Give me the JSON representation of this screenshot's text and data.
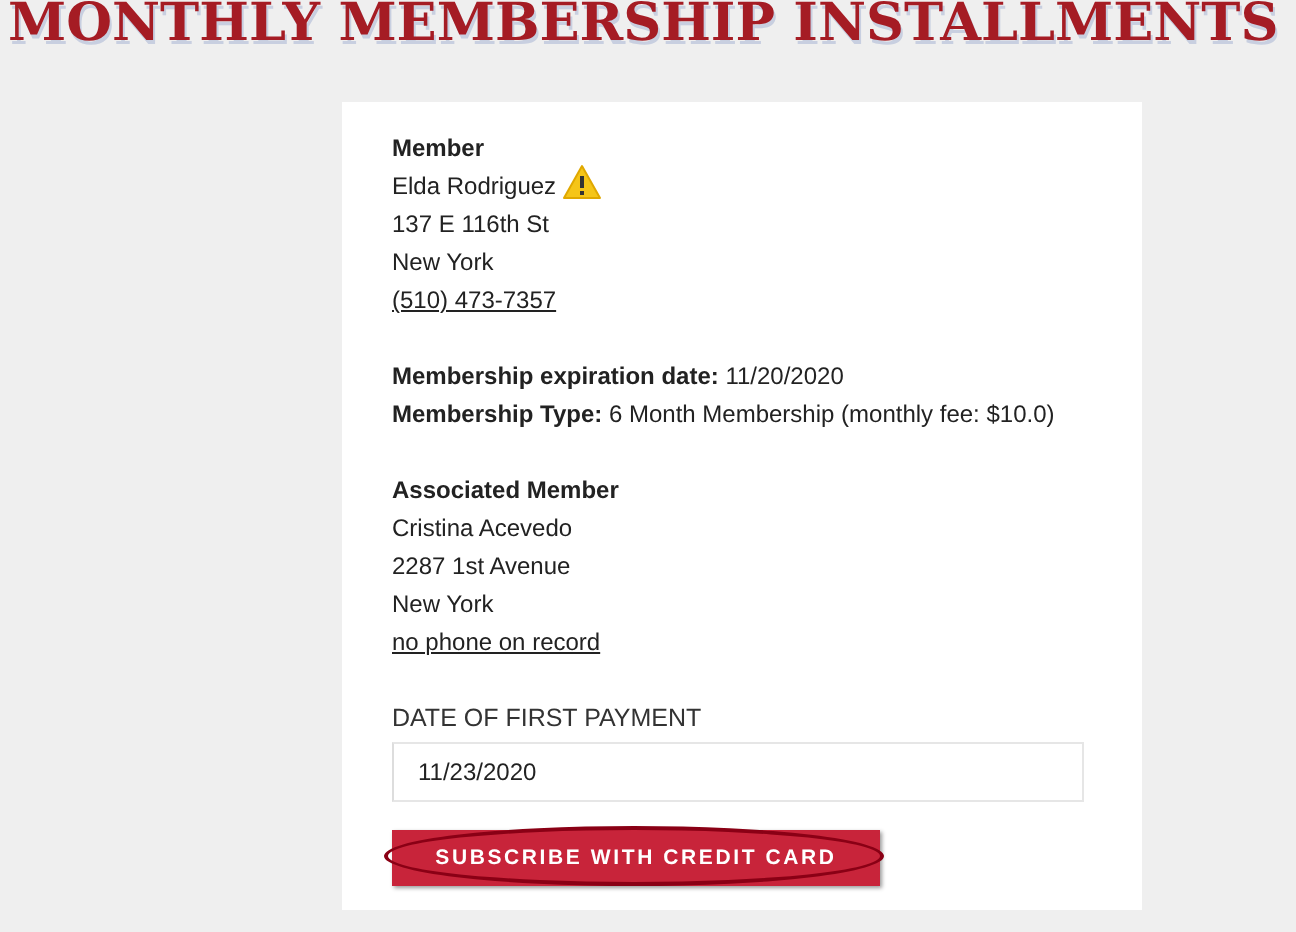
{
  "page_title": "MONTHLY MEMBERSHIP INSTALLMENTS",
  "member": {
    "heading": "Member",
    "name": "Elda Rodriguez",
    "warning": true,
    "address": "137 E 116th St",
    "city": "New York",
    "phone": "(510) 473-7357"
  },
  "membership": [
    {
      "label": "Membership expiration date:",
      "value": "11/20/2020"
    },
    {
      "label": "Membership Type:",
      "value": "6 Month Membership (monthly fee: $10.0)"
    }
  ],
  "associated_member": {
    "heading": "Associated Member",
    "name": "Cristina Acevedo",
    "address": "2287 1st Avenue",
    "city": "New York",
    "phone": "no phone on record"
  },
  "first_payment": {
    "label": "DATE OF FIRST PAYMENT",
    "value": "11/23/2020"
  },
  "submit": {
    "label": "SUBSCRIBE WITH CREDIT CARD",
    "highlighted": true
  }
}
